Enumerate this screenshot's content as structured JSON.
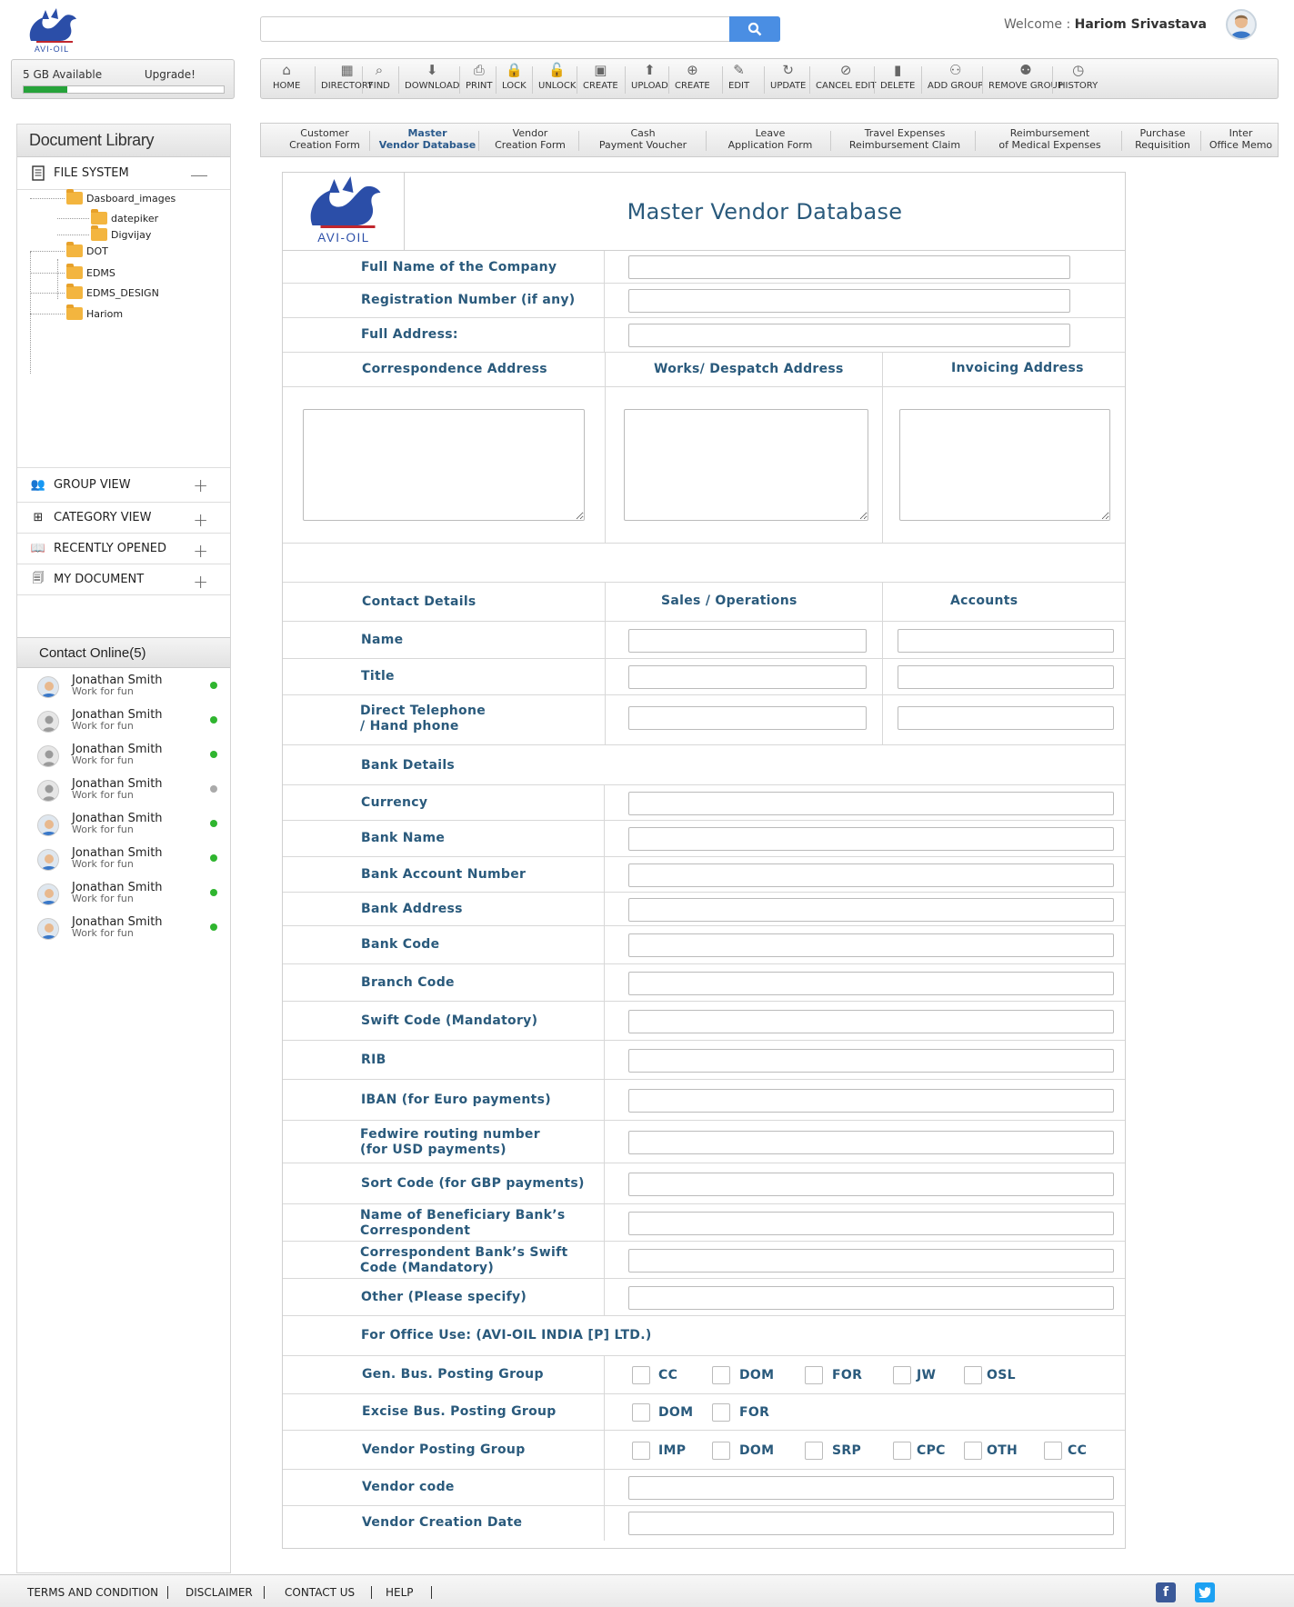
{
  "brand": {
    "logo_text": "AVI-OIL"
  },
  "storage": {
    "available": "5 GB Available",
    "upgrade": "Upgrade!",
    "used_fraction": 0.22
  },
  "search": {
    "placeholder": ""
  },
  "user": {
    "welcome": "Welcome :",
    "name": "Hariom Srivastava"
  },
  "toolbar": [
    {
      "label": "HOME",
      "icon": "home-icon"
    },
    {
      "label": "DIRECTORY",
      "icon": "directory-icon"
    },
    {
      "label": "FIND",
      "icon": "find-icon"
    },
    {
      "label": "DOWNLOAD",
      "icon": "download-icon"
    },
    {
      "label": "PRINT",
      "icon": "print-icon"
    },
    {
      "label": "LOCK",
      "icon": "lock-icon"
    },
    {
      "label": "UNLOCK",
      "icon": "unlock-icon"
    },
    {
      "label": "CREATE",
      "icon": "create-folder-icon"
    },
    {
      "label": "UPLOAD",
      "icon": "upload-icon"
    },
    {
      "label": "CREATE",
      "icon": "create-doc-icon"
    },
    {
      "label": "EDIT",
      "icon": "edit-icon"
    },
    {
      "label": "UPDATE",
      "icon": "update-icon"
    },
    {
      "label": "CANCEL EDIT",
      "icon": "cancel-edit-icon"
    },
    {
      "label": "DELETE",
      "icon": "delete-icon"
    },
    {
      "label": "ADD GROUP",
      "icon": "add-group-icon"
    },
    {
      "label": "REMOVE GROUP",
      "icon": "remove-group-icon"
    },
    {
      "label": "HISTORY",
      "icon": "history-icon"
    }
  ],
  "sidebar": {
    "title": "Document Library",
    "file_system": "FILE SYSTEM",
    "tree": [
      "Dasboard_images",
      "datepiker",
      "Digvijay",
      "DOT",
      "EDMS",
      "EDMS_DESIGN",
      "Hariom"
    ],
    "sections": [
      "GROUP VIEW",
      "CATEGORY VIEW",
      "RECENTLY OPENED",
      "MY DOCUMENT"
    ],
    "contacts_title": "Contact Online(5)",
    "contacts": [
      {
        "name": "Jonathan Smith",
        "status": "Work for fun",
        "online": true,
        "photo": true
      },
      {
        "name": "Jonathan Smith",
        "status": "Work for fun",
        "online": true,
        "photo": false
      },
      {
        "name": "Jonathan Smith",
        "status": "Work for fun",
        "online": true,
        "photo": false
      },
      {
        "name": "Jonathan Smith",
        "status": "Work for fun",
        "online": false,
        "photo": false
      },
      {
        "name": "Jonathan Smith",
        "status": "Work for fun",
        "online": true,
        "photo": true
      },
      {
        "name": "Jonathan Smith",
        "status": "Work for fun",
        "online": true,
        "photo": true
      },
      {
        "name": "Jonathan Smith",
        "status": "Work for fun",
        "online": true,
        "photo": true
      },
      {
        "name": "Jonathan Smith",
        "status": "Work for fun",
        "online": true,
        "photo": true
      }
    ]
  },
  "tabs": [
    {
      "l1": "Customer",
      "l2": "Creation Form"
    },
    {
      "l1": "Master",
      "l2": "Vendor Database",
      "active": true
    },
    {
      "l1": "Vendor",
      "l2": "Creation Form"
    },
    {
      "l1": "Cash",
      "l2": "Payment Voucher"
    },
    {
      "l1": "Leave",
      "l2": "Application Form"
    },
    {
      "l1": "Travel Expenses",
      "l2": "Reimbursement Claim"
    },
    {
      "l1": "Reimbursement",
      "l2": "of Medical Expenses"
    },
    {
      "l1": "Purchase",
      "l2": "Requisition"
    },
    {
      "l1": "Inter",
      "l2": "Office Memo"
    }
  ],
  "form": {
    "title": "Master Vendor Database",
    "company_name": "Full Name of the Company",
    "registration": "Registration Number (if any)",
    "full_address": "Full Address:",
    "correspondence": "Correspondence Address",
    "works": "Works/ Despatch Address",
    "invoicing": "Invoicing Address",
    "contact_details": "Contact Details",
    "sales_ops": "Sales  / Operations",
    "accounts": "Accounts",
    "name": "Name",
    "title_lbl": "Title",
    "phone_l1": "Direct Telephone",
    "phone_l2": "/ Hand phone",
    "bank_details": "Bank Details",
    "currency": "Currency",
    "bank_name": "Bank Name",
    "bank_account": "Bank Account Number",
    "bank_address": "Bank Address",
    "bank_code": "Bank Code",
    "branch_code": "Branch Code",
    "swift": "Swift Code (Mandatory)",
    "rib": "RIB",
    "iban": "IBAN (for Euro payments)",
    "fedwire_l1": "Fedwire routing number",
    "fedwire_l2": "(for USD payments)",
    "sort_code": "Sort Code (for GBP payments)",
    "beneficiary_l1": "Name of Beneficiary Bank’s",
    "beneficiary_l2": "Correspondent",
    "corr_swift_l1": "Correspondent Bank’s Swift",
    "corr_swift_l2": "Code (Mandatory)",
    "other": "Other (Please specify)",
    "office_use": "For Office Use: (AVI-OIL INDIA [P] LTD.)",
    "gen_bus": "Gen. Bus. Posting Group",
    "gen_bus_opts": [
      "CC",
      "DOM",
      "FOR",
      "JW",
      "OSL"
    ],
    "excise": "Excise Bus. Posting Group",
    "excise_opts": [
      "DOM",
      "FOR"
    ],
    "vendor_posting": "Vendor Posting Group",
    "vendor_posting_opts": [
      "IMP",
      "DOM",
      "SRP",
      "CPC",
      "OTH",
      "CC"
    ],
    "vendor_code": "Vendor code",
    "vendor_date": "Vendor Creation Date"
  },
  "footer": {
    "links": [
      "TERMS AND CONDITION",
      "DISCLAIMER",
      "CONTACT US",
      "HELP"
    ],
    "facebook": "f",
    "twitter": "t"
  },
  "colors": {
    "accent": "#4a8ee3",
    "label": "#2a5a7c",
    "online": "#2fb52f",
    "offline": "#aaaaaa",
    "progress": "#26a33a"
  }
}
